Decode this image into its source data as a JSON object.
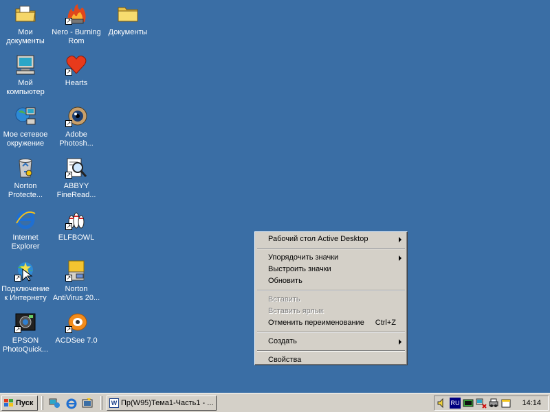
{
  "desktop": {
    "icons": [
      {
        "name": "my-documents",
        "label": "Мои документы"
      },
      {
        "name": "nero",
        "label": "Nero - Burning Rom"
      },
      {
        "name": "documents-folder",
        "label": "Документы"
      },
      {
        "name": "my-computer",
        "label": "Мой компьютер"
      },
      {
        "name": "hearts",
        "label": "Hearts"
      },
      {
        "name": "network",
        "label": "Мое сетевое окружение"
      },
      {
        "name": "photoshop",
        "label": "Adobe Photosh..."
      },
      {
        "name": "norton-protected",
        "label": "Norton Protecte..."
      },
      {
        "name": "abbyy",
        "label": "ABBYY FineRead..."
      },
      {
        "name": "internet-explorer",
        "label": "Internet Explorer"
      },
      {
        "name": "elfbowl",
        "label": "ELFBOWL"
      },
      {
        "name": "internet-connect",
        "label": "Подключение к Интернету"
      },
      {
        "name": "norton-antivirus",
        "label": "Norton AntiVirus 20..."
      },
      {
        "name": "epson",
        "label": "EPSON PhotoQuick..."
      },
      {
        "name": "acdsee",
        "label": "ACDSee 7.0"
      }
    ]
  },
  "context_menu": {
    "items": [
      {
        "label": "Рабочий стол Active Desktop",
        "submenu": true
      },
      {
        "label": "Упорядочить значки",
        "submenu": true
      },
      {
        "label": "Выстроить значки"
      },
      {
        "label": "Обновить"
      },
      {
        "label": "Вставить",
        "disabled": true
      },
      {
        "label": "Вставить ярлык",
        "disabled": true
      },
      {
        "label": "Отменить переименование",
        "accel": "Ctrl+Z"
      },
      {
        "label": "Создать",
        "submenu": true
      },
      {
        "label": "Свойства"
      }
    ]
  },
  "taskbar": {
    "start_label": "Пуск",
    "task_button": "Пр(W95)Тема1-Часть1 - ...",
    "tray": {
      "language": "RU",
      "clock": "14:14"
    }
  },
  "colors": {
    "desktop": "#3a6ea5",
    "face": "#d4d0c8"
  }
}
